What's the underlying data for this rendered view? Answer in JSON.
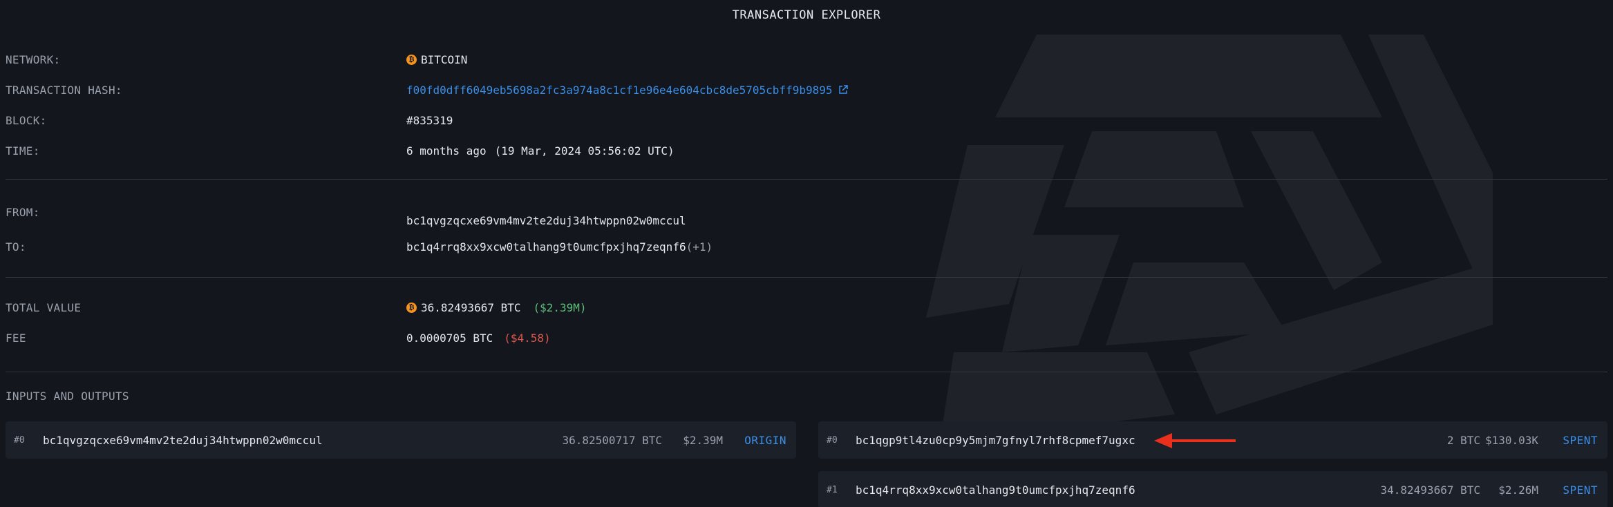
{
  "page_title": "TRANSACTION EXPLORER",
  "network": {
    "label": "NETWORK:",
    "value": "BITCOIN",
    "icon": "bitcoin-icon"
  },
  "tx_hash": {
    "label": "TRANSACTION HASH:",
    "value": "f00fd0dff6049eb5698a2fc3a974a8c1cf1e96e4e604cbc8de5705cbff9b9895",
    "icon": "external-link-icon"
  },
  "block": {
    "label": "BLOCK:",
    "value": "#835319"
  },
  "time": {
    "label": "TIME:",
    "relative": "6 months ago",
    "absolute": "(19 Mar, 2024 05:56:02 UTC)"
  },
  "from": {
    "label": "FROM:",
    "value": "bc1qvgzqcxe69vm4mv2te2duj34htwppn02w0mccul"
  },
  "to": {
    "label": "TO:",
    "value": "bc1q4rrq8xx9xcw0talhang9t0umcfpxjhq7zeqnf6",
    "extra": "(+1)"
  },
  "total_value": {
    "label": "TOTAL VALUE",
    "btc": "36.82493667 BTC",
    "usd": "($2.39M)"
  },
  "fee": {
    "label": "FEE",
    "btc": "0.0000705 BTC",
    "usd": "($4.58)"
  },
  "io_section_label": "INPUTS AND OUTPUTS",
  "inputs": [
    {
      "index": "#0",
      "address": "bc1qvgzqcxe69vm4mv2te2duj34htwppn02w0mccul",
      "btc": "36.82500717 BTC",
      "usd": "$2.39M",
      "tag": "ORIGIN"
    }
  ],
  "outputs": [
    {
      "index": "#0",
      "address": "bc1qgp9tl4zu0cp9y5mjm7gfnyl7rhf8cpmef7ugxc",
      "btc": "2 BTC",
      "usd": "$130.03K",
      "tag": "SPENT"
    },
    {
      "index": "#1",
      "address": "bc1q4rrq8xx9xcw0talhang9t0umcfpxjhq7zeqnf6",
      "btc": "34.82493667 BTC",
      "usd": "$2.26M",
      "tag": "SPENT"
    }
  ],
  "colors": {
    "background": "#13161c",
    "accent_link": "#3b8fe8",
    "bitcoin": "#f7931a",
    "usd_positive": "#5dbf7a",
    "usd_fee": "#e0574a",
    "arrow": "#e8301c"
  }
}
